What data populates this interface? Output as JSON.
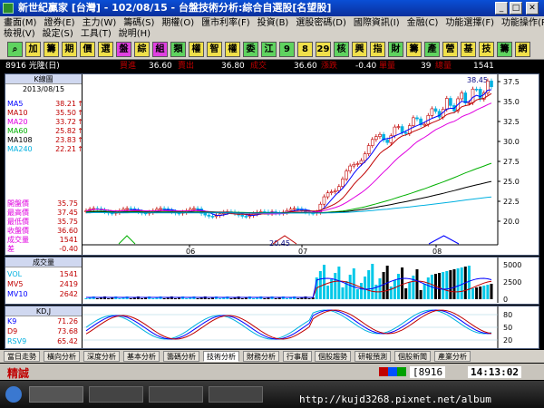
{
  "window": {
    "title": "新世紀贏家 [台灣] - 102/08/15 - 台盤技術分析:綜合自選股[名望股]"
  },
  "menu": {
    "row1": [
      "畫面(M)",
      "證券(E)",
      "主力(W)",
      "籌碼(S)",
      "期權(O)",
      "匯市利率(F)",
      "投資(B)",
      "選股密碼(D)",
      "國際資訊(I)",
      "金融(C)",
      "功能選擇(F)",
      "功能操作(P)"
    ],
    "row2": [
      "檢視(V)",
      "設定(S)",
      "工具(T)",
      "說明(H)"
    ]
  },
  "toolbar": {
    "buttons": [
      {
        "label": "⌕",
        "bg": "#5fd35f"
      },
      {
        "label": "加",
        "bg": "#f0e04a"
      },
      {
        "label": "籌",
        "bg": "#f0e04a"
      },
      {
        "label": "期",
        "bg": "#f0e04a"
      },
      {
        "label": "價",
        "bg": "#f0e04a"
      },
      {
        "label": "選",
        "bg": "#f0e04a"
      },
      {
        "label": "盤",
        "bg": "#e040e0"
      },
      {
        "label": "綜",
        "bg": "#f0e04a"
      },
      {
        "label": "組",
        "bg": "#e040e0"
      },
      {
        "label": "類",
        "bg": "#5fd35f"
      },
      {
        "label": "權",
        "bg": "#f0e04a"
      },
      {
        "label": "智",
        "bg": "#f0e04a"
      },
      {
        "label": "權",
        "bg": "#f0e04a"
      },
      {
        "label": "委",
        "bg": "#5fd35f"
      },
      {
        "label": "江",
        "bg": "#5fd35f"
      },
      {
        "label": "9",
        "bg": "#5fd35f"
      },
      {
        "label": "8",
        "bg": "#f0e04a"
      },
      {
        "label": "29",
        "bg": "#f0e04a"
      },
      {
        "label": "核",
        "bg": "#5fd35f"
      },
      {
        "label": "興",
        "bg": "#f0e04a"
      },
      {
        "label": "指",
        "bg": "#f0e04a"
      },
      {
        "label": "財",
        "bg": "#5fd35f"
      },
      {
        "label": "籌",
        "bg": "#f0e04a"
      },
      {
        "label": "產",
        "bg": "#5fd35f"
      },
      {
        "label": "營",
        "bg": "#f0e04a"
      },
      {
        "label": "基",
        "bg": "#f0e04a"
      },
      {
        "label": "技",
        "bg": "#f0e04a"
      },
      {
        "label": "籌",
        "bg": "#5fd35f"
      },
      {
        "label": "網",
        "bg": "#f0e04a"
      }
    ]
  },
  "info": {
    "stock": "8916 光隆(日)",
    "buy_label": "買進",
    "buy_value": "36.60",
    "sell_label": "賣出",
    "sell_value": "36.80",
    "deal_label": "成交",
    "deal_value": "36.60",
    "change_label": "漲跌",
    "change_value": "-0.40",
    "single_label": "單量",
    "single_value": "39",
    "total_label": "總量",
    "total_value": "1541"
  },
  "kpanel": {
    "header": "K線圖",
    "date": "2013/08/15",
    "ma": [
      {
        "label": "MA5",
        "value": "38.21",
        "arrow": "↑",
        "color": "#0000ff"
      },
      {
        "label": "MA10",
        "value": "35.50",
        "arrow": "↑",
        "color": "#c00000"
      },
      {
        "label": "MA20",
        "value": "33.72",
        "arrow": "↑",
        "color": "#e000e0"
      },
      {
        "label": "MA60",
        "value": "25.82",
        "arrow": "↑",
        "color": "#00b000"
      },
      {
        "label": "MA108",
        "value": "23.83",
        "arrow": "↑",
        "color": "#000000"
      },
      {
        "label": "MA240",
        "value": "22.21",
        "arrow": "↑",
        "color": "#00b0e0"
      }
    ],
    "ohlc": [
      {
        "label": "開盤價",
        "value": "35.75",
        "color": "#e000e0"
      },
      {
        "label": "最高價",
        "value": "37.45",
        "color": "#e000e0"
      },
      {
        "label": "最低價",
        "value": "35.75",
        "color": "#e000e0"
      },
      {
        "label": "收盤價",
        "value": "36.60",
        "color": "#e000e0"
      },
      {
        "label": "成交量",
        "value": "1541",
        "color": "#e000e0"
      },
      {
        "label": "差",
        "value": "-0.40",
        "color": "#e000e0"
      }
    ],
    "yticks": [
      "37.5",
      "35.0",
      "32.5",
      "30.0",
      "27.5",
      "25.0",
      "22.5",
      "20.0"
    ],
    "high_label": "38.45",
    "low_label": "20.45",
    "xlabels": [
      "06",
      "07",
      "08"
    ]
  },
  "volpanel": {
    "header": "成交量",
    "rows": [
      {
        "label": "VOL",
        "value": "1541",
        "color": "#00b0e0"
      },
      {
        "label": "MV5",
        "value": "2419",
        "color": "#c00000"
      },
      {
        "label": "MV10",
        "value": "2642",
        "color": "#0000ff"
      }
    ],
    "yticks": [
      "5000",
      "2500",
      "0"
    ]
  },
  "kdpanel": {
    "header": "KD,J",
    "rows": [
      {
        "label": "K9",
        "value": "71.26",
        "color": "#0000ff"
      },
      {
        "label": "D9",
        "value": "73.68",
        "color": "#c00000"
      },
      {
        "label": "RSV9",
        "value": "65.42",
        "color": "#00b0e0"
      }
    ],
    "yticks": [
      "80",
      "50",
      "20"
    ]
  },
  "tabs": [
    "當日走勢",
    "橫向分析",
    "深度分析",
    "基本分析",
    "籌碼分析",
    "技術分析",
    "財務分析",
    "行事曆",
    "個股趨勢",
    "研報預測",
    "個股新聞",
    "產業分析"
  ],
  "active_tab": "技術分析",
  "status": {
    "left": "精誠",
    "code": "8916",
    "time": "14:13:02"
  },
  "watermark": "http://kujd3268.pixnet.net/album",
  "colors": {
    "up": "#c00000",
    "down": "#00b0e0",
    "axis": "#000000"
  }
}
